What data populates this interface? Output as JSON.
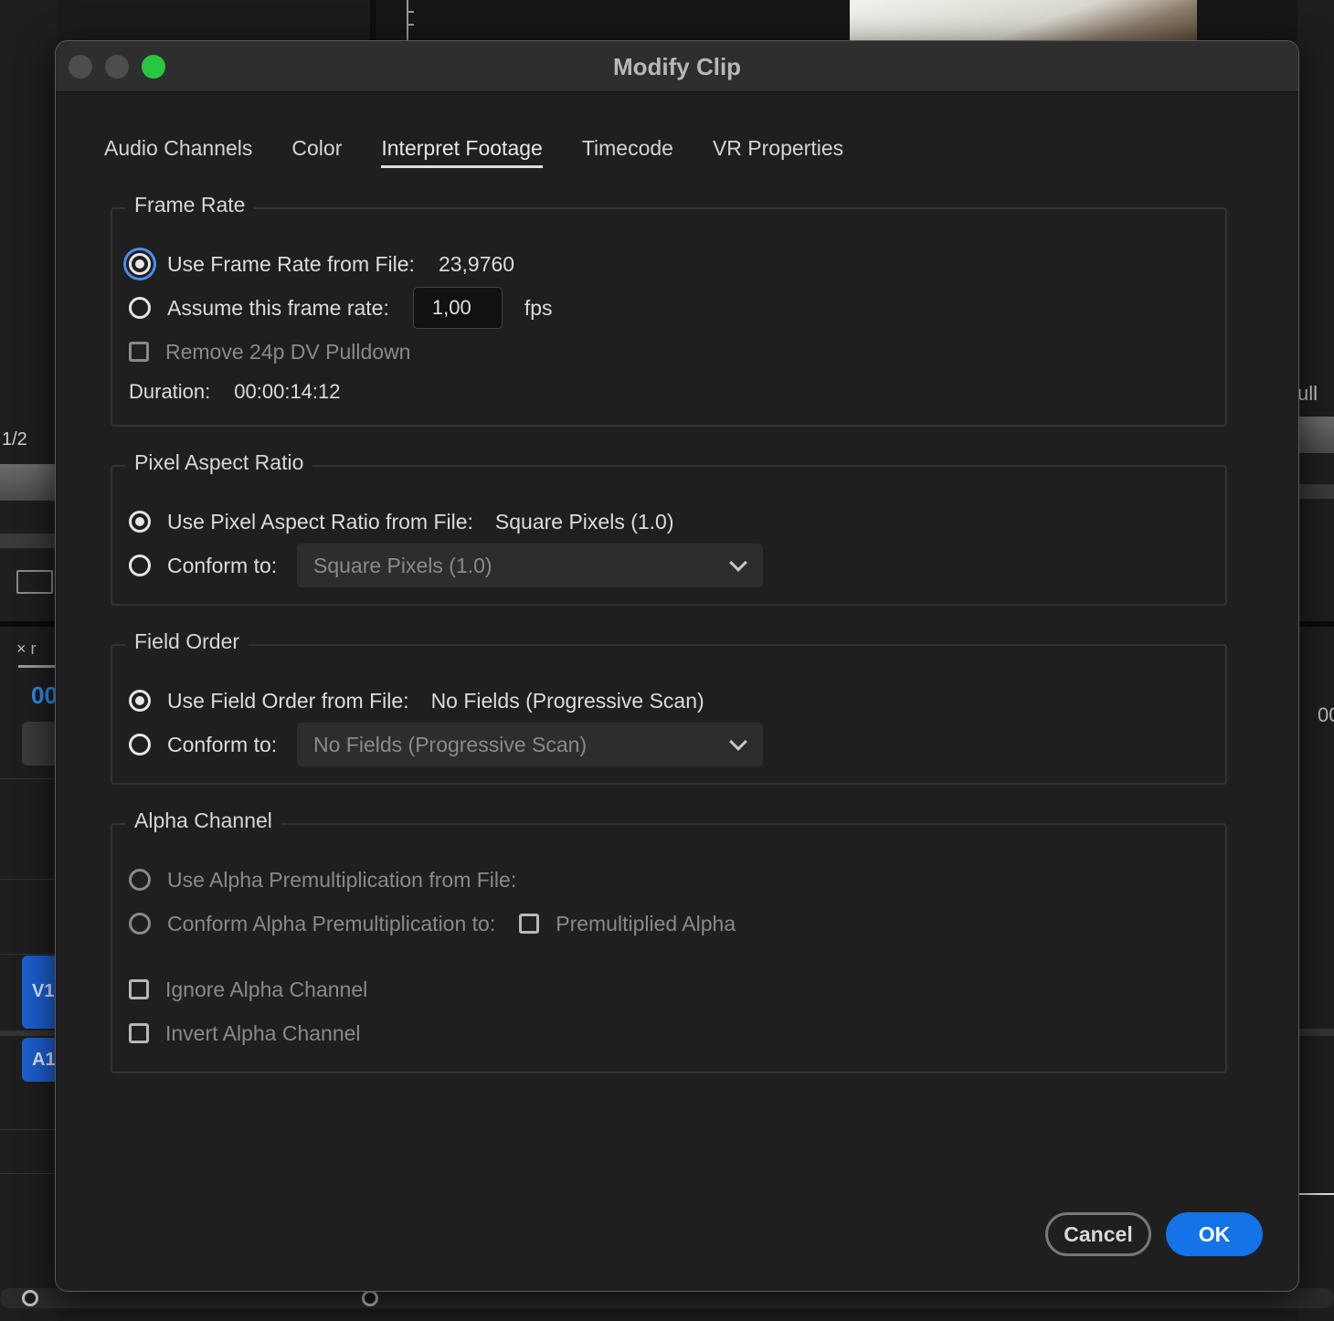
{
  "background": {
    "left_panel_label": "1/2",
    "left_tab_close": "×",
    "left_tab_partial": "r",
    "left_timecode_partial": "00",
    "track_v1": "V1",
    "track_a1": "A1",
    "right_panel_label": "ull",
    "right_timecode_partial": "00"
  },
  "dialog": {
    "title": "Modify Clip",
    "tabs": [
      {
        "label": "Audio Channels",
        "active": false
      },
      {
        "label": "Color",
        "active": false
      },
      {
        "label": "Interpret Footage",
        "active": true
      },
      {
        "label": "Timecode",
        "active": false
      },
      {
        "label": "VR Properties",
        "active": false
      }
    ],
    "frame_rate": {
      "group_label": "Frame Rate",
      "use_from_file_label": "Use Frame Rate from File:",
      "use_from_file_value": "23,9760",
      "assume_label": "Assume this frame rate:",
      "assume_value": "1,00",
      "assume_unit": "fps",
      "remove_pulldown_label": "Remove 24p DV Pulldown",
      "duration_label": "Duration:",
      "duration_value": "00:00:14:12",
      "selected": "use_from_file"
    },
    "pixel_aspect_ratio": {
      "group_label": "Pixel Aspect Ratio",
      "use_from_file_label": "Use Pixel Aspect Ratio from File:",
      "use_from_file_value": "Square Pixels (1.0)",
      "conform_label": "Conform to:",
      "conform_value": "Square Pixels (1.0)",
      "selected": "use_from_file"
    },
    "field_order": {
      "group_label": "Field Order",
      "use_from_file_label": "Use Field Order from File:",
      "use_from_file_value": "No Fields (Progressive Scan)",
      "conform_label": "Conform to:",
      "conform_value": "No Fields (Progressive Scan)",
      "selected": "use_from_file"
    },
    "alpha_channel": {
      "group_label": "Alpha Channel",
      "use_from_file_label": "Use Alpha Premultiplication from File:",
      "conform_label": "Conform Alpha Premultiplication to:",
      "premultiplied_label": "Premultiplied Alpha",
      "ignore_label": "Ignore Alpha Channel",
      "invert_label": "Invert Alpha Channel"
    },
    "buttons": {
      "cancel": "Cancel",
      "ok": "OK"
    },
    "colors": {
      "accent": "#1473e6",
      "focus_ring": "#4b8ef0",
      "maximize": "#29c73f"
    }
  }
}
